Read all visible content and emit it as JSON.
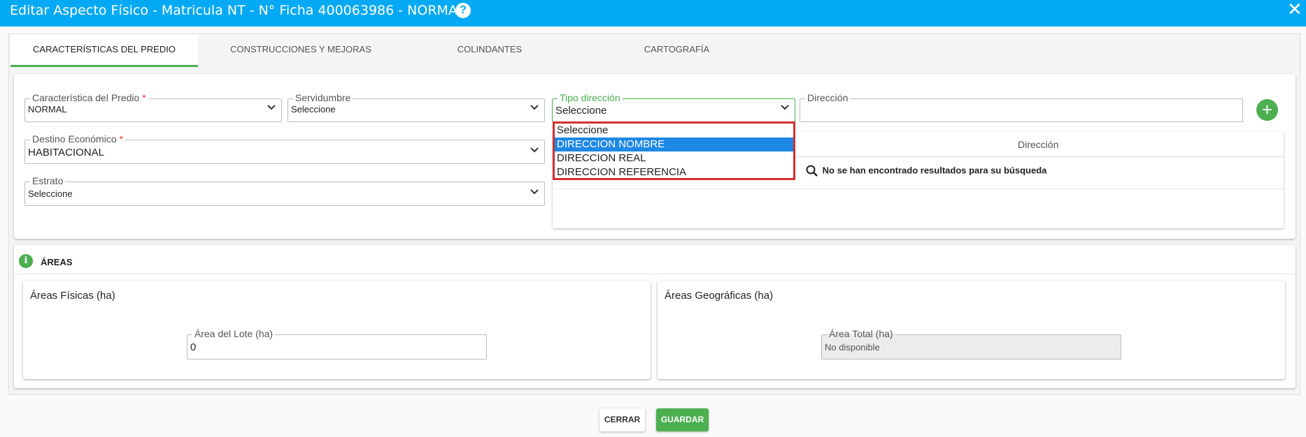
{
  "dialog": {
    "title": "Editar Aspecto Físico - Matricula NT - N° Ficha 400063986 - NORMAL",
    "help_glyph": "?",
    "close_glyph": "✕"
  },
  "tabs": [
    {
      "label": "CARACTERÍSTICAS DEL PREDIO",
      "active": true
    },
    {
      "label": "CONSTRUCCIONES Y MEJORAS",
      "active": false
    },
    {
      "label": "COLINDANTES",
      "active": false
    },
    {
      "label": "CARTOGRAFÍA",
      "active": false
    }
  ],
  "predio": {
    "caracteristica": {
      "label": "Característica del Predio",
      "required_mark": "*",
      "value": "NORMAL"
    },
    "servidumbre": {
      "label": "Servidumbre",
      "value": "Seleccione"
    },
    "destino": {
      "label": "Destino Económico",
      "required_mark": "*",
      "value": "HABITACIONAL"
    },
    "estrato": {
      "label": "Estrato",
      "value": "Seleccione"
    },
    "tipo_direccion": {
      "label": "Tipo dirección",
      "value": "Seleccione",
      "options": [
        "Seleccione",
        "DIRECCION NOMBRE",
        "DIRECCION REAL",
        "DIRECCION REFERENCIA"
      ],
      "highlighted_index": 1
    },
    "direccion": {
      "label": "Dirección",
      "value": ""
    },
    "add_glyph": "+"
  },
  "direcciones_table": {
    "column_header": "Dirección",
    "empty_message": "No se han encontrado resultados para su búsqueda"
  },
  "areas": {
    "section_title": "ÁREAS",
    "info_glyph": "i",
    "fisicas": {
      "title": "Áreas Físicas (ha)",
      "lote_label": "Área del Lote (ha)",
      "lote_value": "0"
    },
    "geograficas": {
      "title": "Áreas Geográficas (ha)",
      "total_label": "Área Total (ha)",
      "total_value": "No disponible"
    }
  },
  "footer": {
    "cerrar": "CERRAR",
    "guardar": "GUARDAR"
  },
  "colors": {
    "header": "#03a9f4",
    "accent_green": "#4caf50",
    "highlight_blue": "#1e88e5",
    "dropdown_border": "#d32f2f"
  }
}
